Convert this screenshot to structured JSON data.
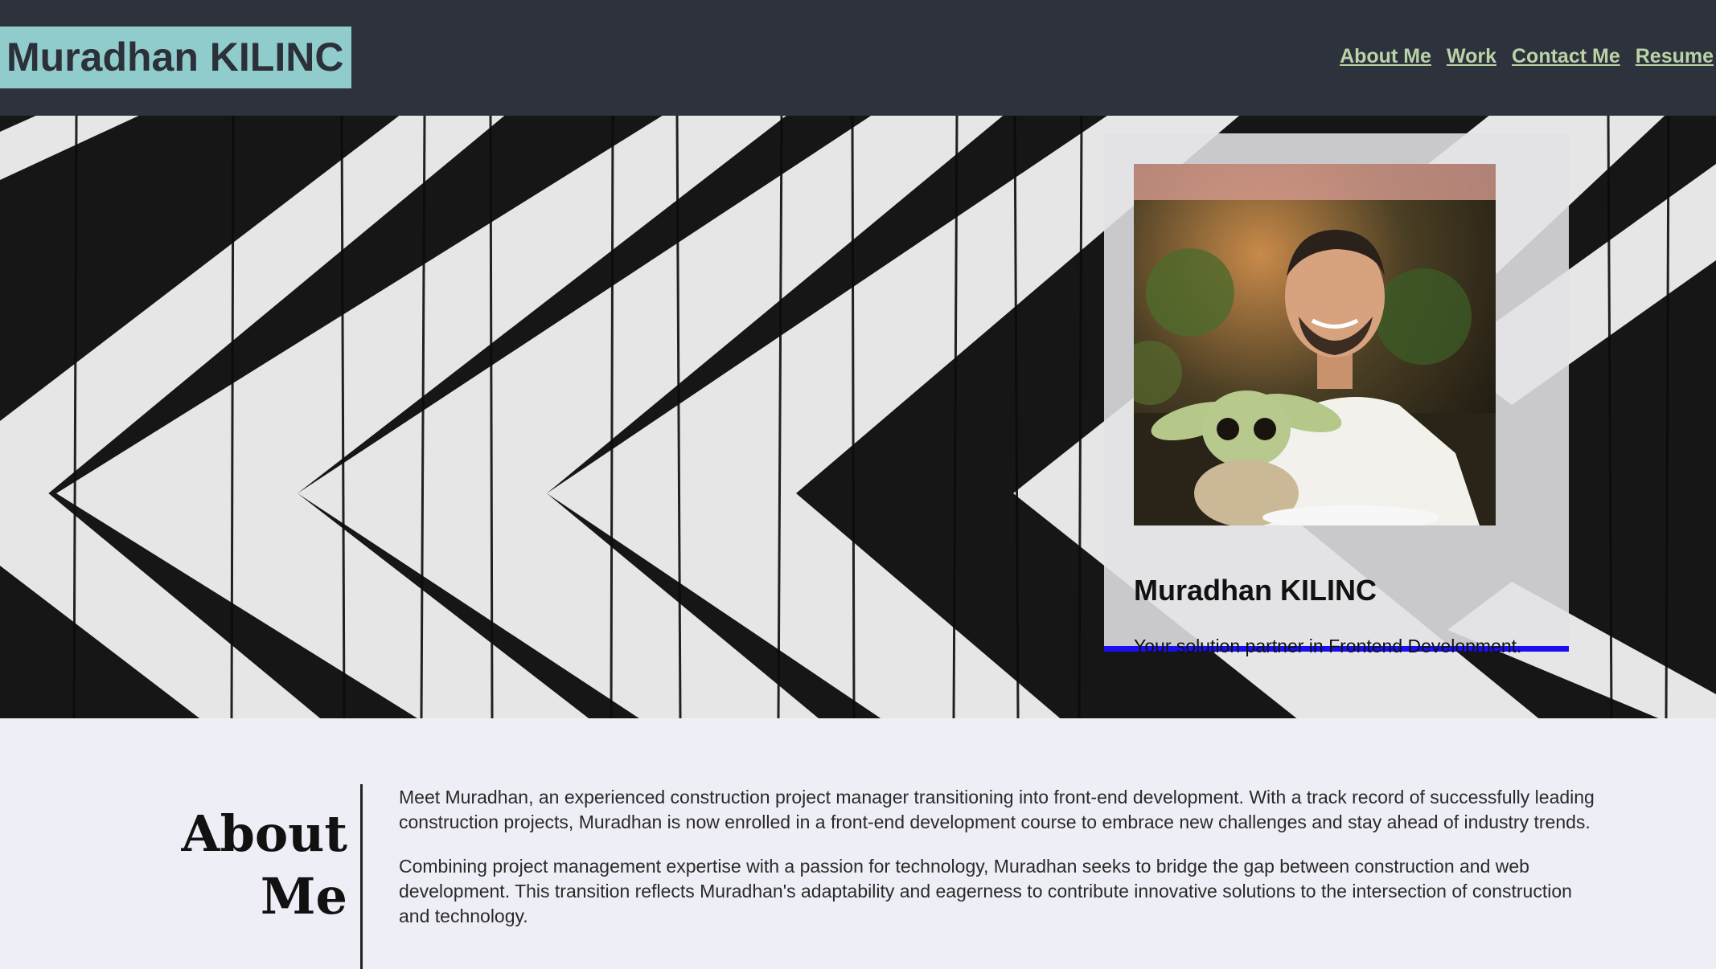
{
  "header": {
    "logo": "Muradhan KILINC",
    "nav": [
      "About Me",
      "Work",
      "Contact Me",
      "Resume"
    ]
  },
  "hero": {
    "name": "Muradhan KILINC",
    "tagline": "Your solution partner in Frontend Development."
  },
  "about": {
    "heading": "About Me",
    "paragraphs": [
      "Meet Muradhan, an experienced construction project manager transitioning into front-end development. With a track record of successfully leading construction projects, Muradhan is now enrolled in a front-end development course to embrace new challenges and stay ahead of industry trends.",
      "Combining project management expertise with a passion for technology, Muradhan seeks to bridge the gap between construction and web development. This transition reflects Muradhan's adaptability and eagerness to contribute innovative solutions to the intersection of construction and technology."
    ]
  },
  "colors": {
    "header_bg": "#2e323c",
    "logo_bg": "#90cccc",
    "nav_link": "#b9d3a6",
    "card_accent": "#1a0ff0",
    "page_bg": "#eeeef6"
  }
}
